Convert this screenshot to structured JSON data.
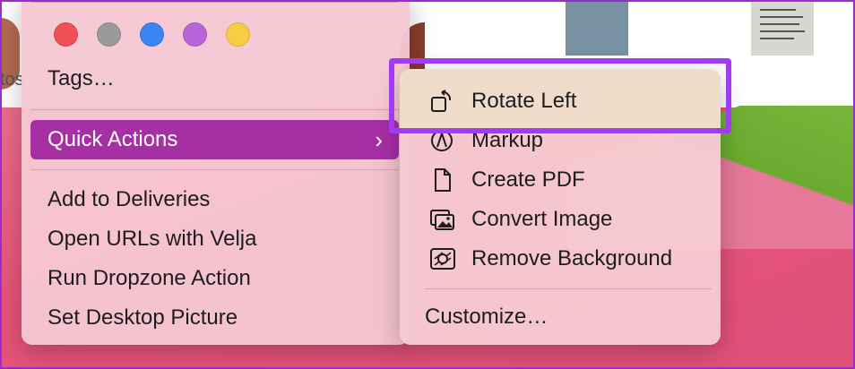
{
  "background": {
    "partial_label": "tos"
  },
  "main_menu": {
    "tag_colors": [
      {
        "name": "red",
        "color": "#ef4f55"
      },
      {
        "name": "gray",
        "color": "#9a9a9c"
      },
      {
        "name": "blue",
        "color": "#3b86f4"
      },
      {
        "name": "purple",
        "color": "#b865d9"
      },
      {
        "name": "yellow",
        "color": "#f7cd41"
      }
    ],
    "tags_label": "Tags…",
    "quick_actions_label": "Quick Actions",
    "items": [
      "Add to Deliveries",
      "Open URLs with Velja",
      "Run Dropzone Action",
      "Set Desktop Picture"
    ]
  },
  "submenu": {
    "items": [
      {
        "label": "Rotate Left",
        "icon": "rotate-left-icon"
      },
      {
        "label": "Markup",
        "icon": "markup-icon"
      },
      {
        "label": "Create PDF",
        "icon": "document-icon"
      },
      {
        "label": "Convert Image",
        "icon": "photos-icon"
      },
      {
        "label": "Remove Background",
        "icon": "remove-background-icon"
      }
    ],
    "customize_label": "Customize…"
  },
  "colors": {
    "accent": "#a62fa4",
    "highlight": "#a23cf0"
  }
}
